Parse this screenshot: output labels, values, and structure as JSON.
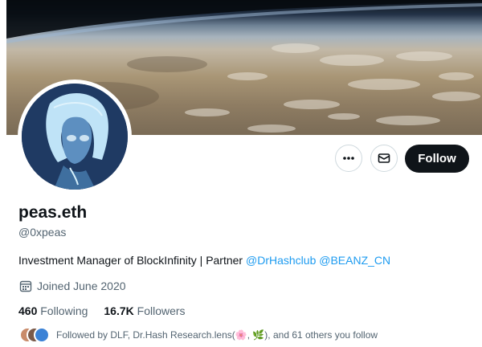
{
  "profile": {
    "name": "peas.eth",
    "handle": "@0xpeas",
    "bio_text": "Investment Manager of BlockInfinity | Partner ",
    "bio_mentions": [
      "@DrHashclub",
      "@BEANZ_CN"
    ],
    "joined": "Joined June 2020",
    "following_count": "460",
    "following_label": "Following",
    "followers_count": "16.7K",
    "followers_label": "Followers",
    "followed_by": "Followed by DLF, Dr.Hash Research.lens(🌸, 🌿), and 61 others you follow"
  },
  "actions": {
    "more_icon": "more-horizontal-icon",
    "message_icon": "envelope-icon",
    "follow_label": "Follow"
  },
  "colors": {
    "accent": "#1d9bf0",
    "text_primary": "#0f1419",
    "text_secondary": "#536471",
    "follow_bg": "#0f1419"
  }
}
